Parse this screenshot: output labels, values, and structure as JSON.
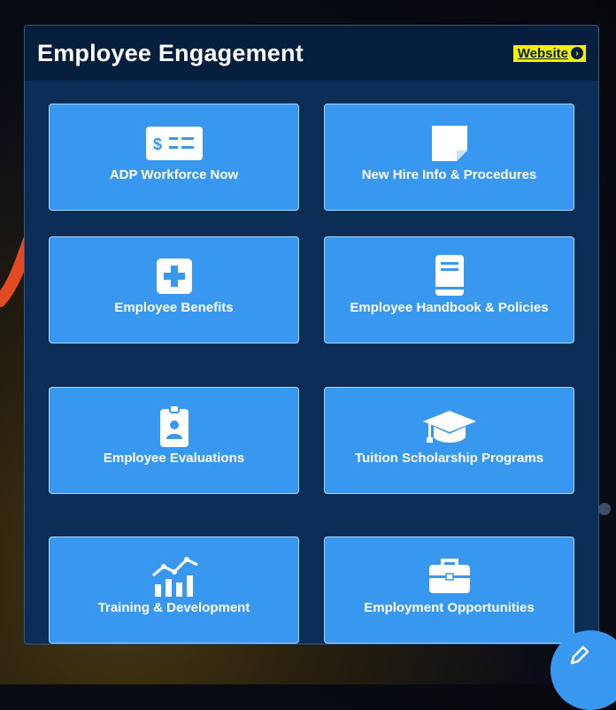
{
  "panel": {
    "title": "Employee Engagement",
    "website_link": "Website"
  },
  "tiles": [
    {
      "label": "ADP Workforce Now",
      "icon": "pay-card-icon"
    },
    {
      "label": "New Hire Info & Procedures",
      "icon": "note-icon"
    },
    {
      "label": "Employee Benefits",
      "icon": "medical-plus-icon"
    },
    {
      "label": "Employee Handbook & Policies",
      "icon": "book-icon"
    },
    {
      "label": "Employee Evaluations",
      "icon": "id-badge-icon"
    },
    {
      "label": "Tuition Scholarship Programs",
      "icon": "graduation-cap-icon"
    },
    {
      "label": "Training & Development",
      "icon": "growth-chart-icon"
    },
    {
      "label": "Employment Opportunities",
      "icon": "briefcase-icon"
    }
  ],
  "colors": {
    "panel_bg": "#0c2d55",
    "header_bg": "#061f3f",
    "tile_bg": "#3897ee",
    "link_highlight": "#f5f000",
    "arrow": "#e24a23"
  }
}
